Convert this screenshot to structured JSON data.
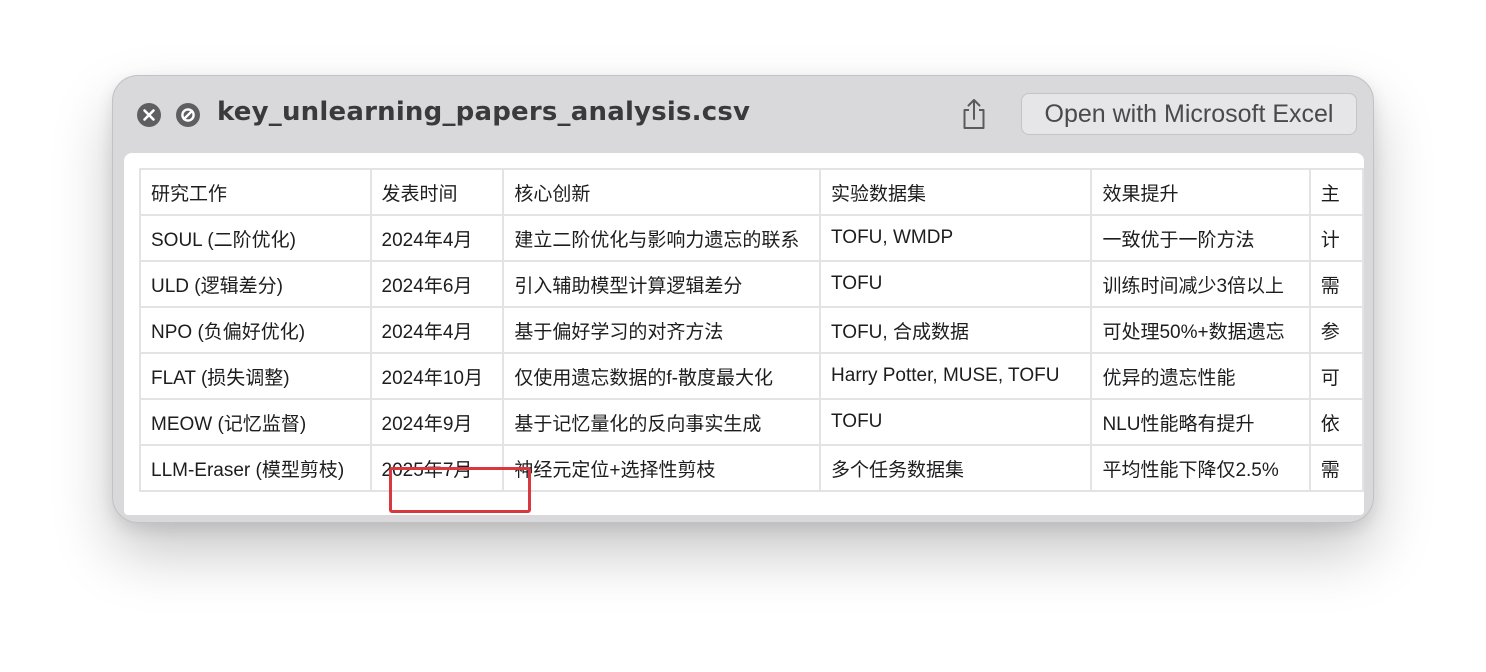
{
  "window": {
    "title": "key_unlearning_papers_analysis.csv",
    "open_button_label": "Open with Microsoft Excel",
    "icons": {
      "close": "close-icon",
      "fullscreen_disabled": "no-zoom-icon",
      "share": "share-icon"
    }
  },
  "table": {
    "headers": [
      "研究工作",
      "发表时间",
      "核心创新",
      "实验数据集",
      "效果提升",
      "主"
    ],
    "rows": [
      [
        "SOUL (二阶优化)",
        "2024年4月",
        "建立二阶优化与影响力遗忘的联系",
        "TOFU, WMDP",
        "一致优于一阶方法",
        "计"
      ],
      [
        "ULD (逻辑差分)",
        "2024年6月",
        "引入辅助模型计算逻辑差分",
        "TOFU",
        "训练时间减少3倍以上",
        "需"
      ],
      [
        "NPO (负偏好优化)",
        "2024年4月",
        "基于偏好学习的对齐方法",
        "TOFU, 合成数据",
        "可处理50%+数据遗忘",
        "参"
      ],
      [
        "FLAT (损失调整)",
        "2024年10月",
        "仅使用遗忘数据的f-散度最大化",
        "Harry Potter, MUSE, TOFU",
        "优异的遗忘性能",
        "可"
      ],
      [
        "MEOW (记忆监督)",
        "2024年9月",
        "基于记忆量化的反向事实生成",
        "TOFU",
        "NLU性能略有提升",
        "依"
      ],
      [
        "LLM-Eraser (模型剪枝)",
        "2025年7月",
        "神经元定位+选择性剪枝",
        "多个任务数据集",
        "平均性能下降仅2.5%",
        "需"
      ]
    ],
    "highlighted_cell": "2025年7月",
    "highlight_color": "#d9393e",
    "grid_color": "#e3e3e5"
  }
}
